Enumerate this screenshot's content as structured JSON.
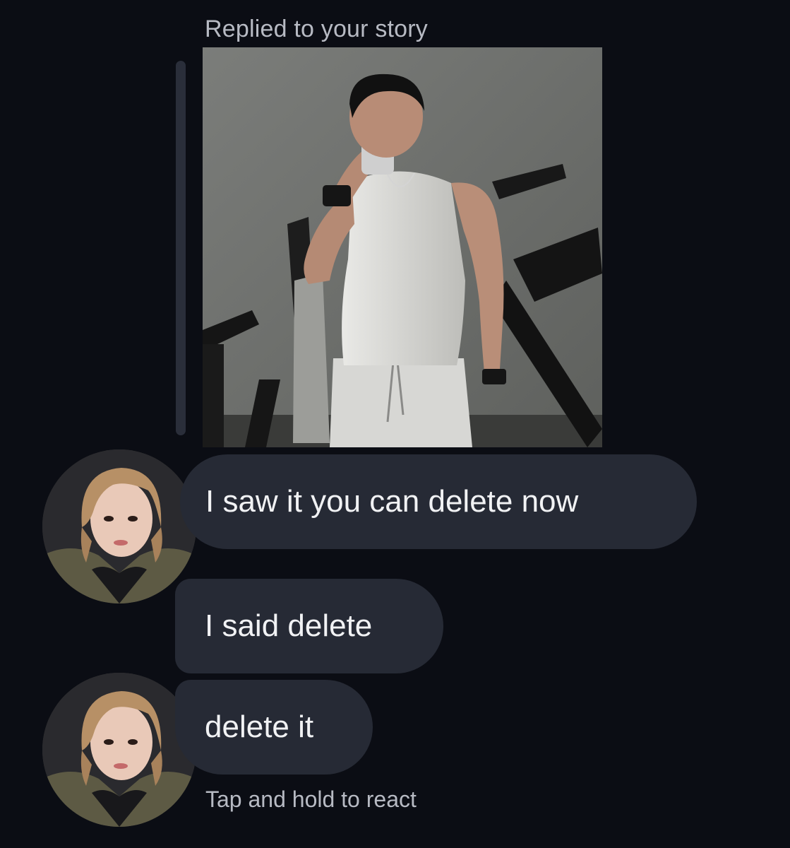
{
  "story_reply": {
    "label": "Replied to your story",
    "image_icon": "story-photo"
  },
  "messages": [
    {
      "text": "I saw it you can delete now"
    },
    {
      "text": "I said delete"
    },
    {
      "text": "delete it"
    }
  ],
  "hint": "Tap and hold to react",
  "colors": {
    "background": "#0b0d14",
    "bubble": "#262a35",
    "secondary_text": "#b7bac3"
  }
}
